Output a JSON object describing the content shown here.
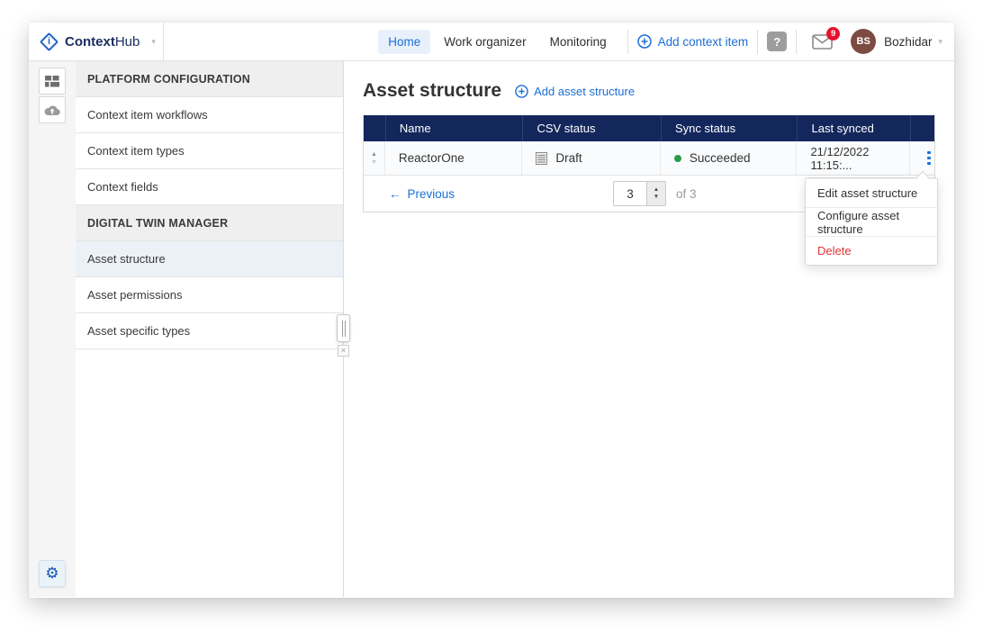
{
  "topbar": {
    "brand": {
      "name_bold": "Context",
      "name_light": "Hub",
      "chevron": "▾"
    },
    "nav_items": [
      {
        "label": "Home"
      },
      {
        "label": "Work organizer"
      },
      {
        "label": "Monitoring"
      }
    ],
    "add_context_item_label": "Add context item",
    "help_glyph": "?",
    "notification_badge": "9",
    "user": {
      "initials": "BS",
      "name": "Bozhidar",
      "chevron": "▾"
    }
  },
  "left_rail": {
    "gear_glyph": "⚙"
  },
  "nav_panel": {
    "section1_header": "PLATFORM CONFIGURATION",
    "section1_items": [
      "Context item workflows",
      "Context item types",
      "Context fields"
    ],
    "section2_header": "DIGITAL TWIN MANAGER",
    "section2_items": [
      "Asset structure",
      "Asset permissions",
      "Asset specific types"
    ],
    "selected_item": "Asset structure",
    "scrollbar_close_glyph": "×"
  },
  "main": {
    "title": "Asset structure",
    "add_link_label": "Add asset structure",
    "table": {
      "columns": [
        "Name",
        "CSV status",
        "Sync status",
        "Last synced"
      ],
      "rows": [
        {
          "name": "ReactorOne",
          "csv_status": "Draft",
          "sync_status": "Succeeded",
          "last_synced": "21/12/2022 11:15:..."
        }
      ]
    },
    "pagination": {
      "previous_arrow": "←",
      "previous_label": "Previous",
      "page_value": "3",
      "of_label": "of 3"
    }
  },
  "context_menu": {
    "items": [
      {
        "label": "Edit asset structure"
      },
      {
        "label": "Configure asset structure"
      },
      {
        "label": "Delete"
      }
    ]
  },
  "icons": {
    "sort_up": "▲",
    "sort_down": "▼",
    "spinner_up": "▲",
    "spinner_down": "▼"
  },
  "colors": {
    "table_header_navy": "#14275c",
    "link_blue": "#1a6fd4",
    "active_nav_bg": "#e8f1fb",
    "success_green": "#2b9a4a",
    "danger_red": "#e23636",
    "badge_red": "#e8112d",
    "avatar_brown": "#7d4b41"
  }
}
